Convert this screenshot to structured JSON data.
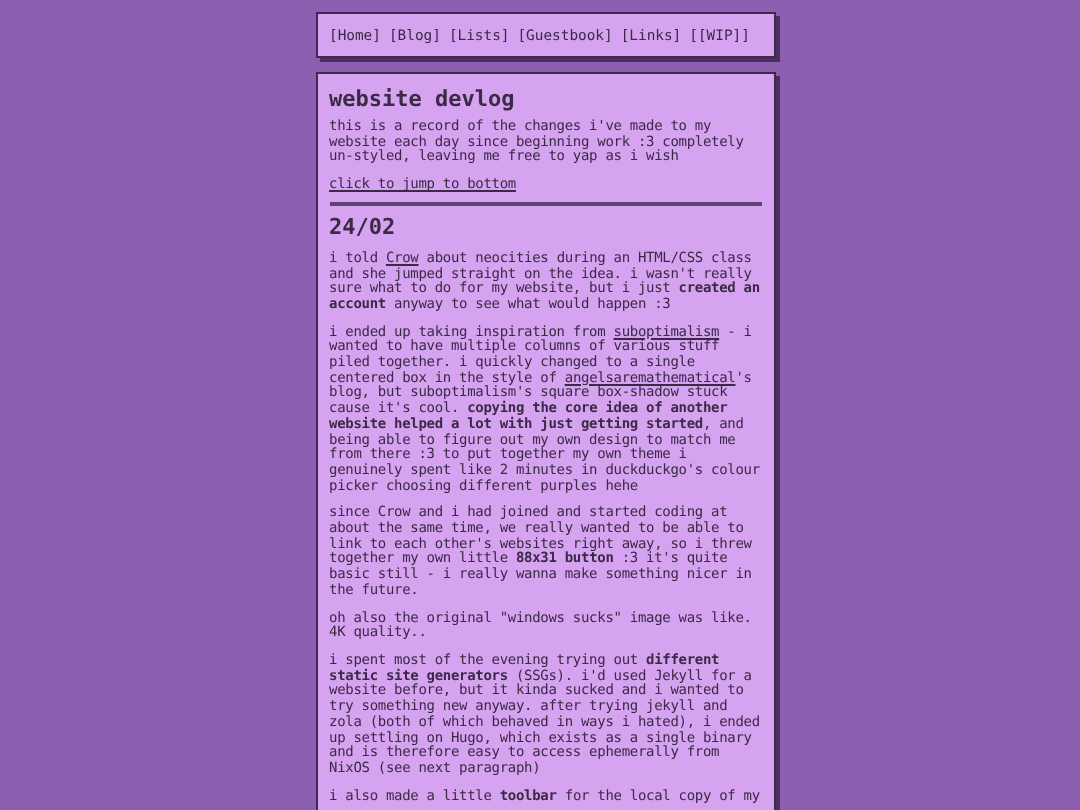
{
  "nav": {
    "links": [
      "[Home]",
      "[Blog]",
      "[Lists]",
      "[Guestbook]",
      "[Links]",
      "[[WIP]]"
    ]
  },
  "page": {
    "title": "website devlog",
    "intro": "this is a record of the changes i've made to my website each day since beginning work :3 completely un-styled, leaving me free to yap as i wish",
    "jump_link": "click to jump to bottom",
    "entries": [
      {
        "date": "24/02",
        "paragraphs": [
          [
            {
              "kind": "text",
              "text": "i told "
            },
            {
              "kind": "link",
              "text": "Crow"
            },
            {
              "kind": "text",
              "text": " about neocities during an HTML/CSS class and she jumped straight on the idea. i wasn't really sure what to do for my website, but i just **created an account** anyway to see what would happen :3"
            }
          ],
          [
            {
              "kind": "text",
              "text": "i ended up taking inspiration from "
            },
            {
              "kind": "link",
              "text": "suboptimalism"
            },
            {
              "kind": "text",
              "text": " - i wanted to have multiple columns of various stuff piled together. i quickly changed to a single centered box in the style of "
            },
            {
              "kind": "link",
              "text": "angelsaremathematical"
            },
            {
              "kind": "text",
              "text": "'s blog, but suboptimalism's square box-shadow stuck cause it's cool. **copying the core idea of another website helped a lot with just getting started**, and being able to figure out my own design to match me from there :3 to put together my own theme i genuinely spent like 2 minutes in duckduckgo's colour picker choosing different purples hehe"
            }
          ],
          [
            {
              "kind": "text",
              "text": "since Crow and i had joined and started coding at about the same time, we really wanted to be able to link to each other's websites right away, so i threw together my own little **88x31 button** :3 it's quite basic still - i really wanna make something nicer in the future."
            }
          ],
          [
            {
              "kind": "text",
              "text": "oh also the original \"windows sucks\" image was like. 4K quality.."
            }
          ],
          [
            {
              "kind": "text",
              "text": "i spent most of the evening trying out **different static site generators** (SSGs). i'd used Jekyll for a website before, but it kinda sucked and i wanted to try something new anyway. after trying jekyll and zola (both of which behaved in ways i hated), i ended up settling on Hugo, which exists as a single binary and is therefore easy to access ephemerally from NixOS (see next paragraph)"
            }
          ],
          [
            {
              "kind": "text",
              "text": "i also made a little **toolbar** for the local copy of my"
            }
          ]
        ]
      }
    ]
  }
}
